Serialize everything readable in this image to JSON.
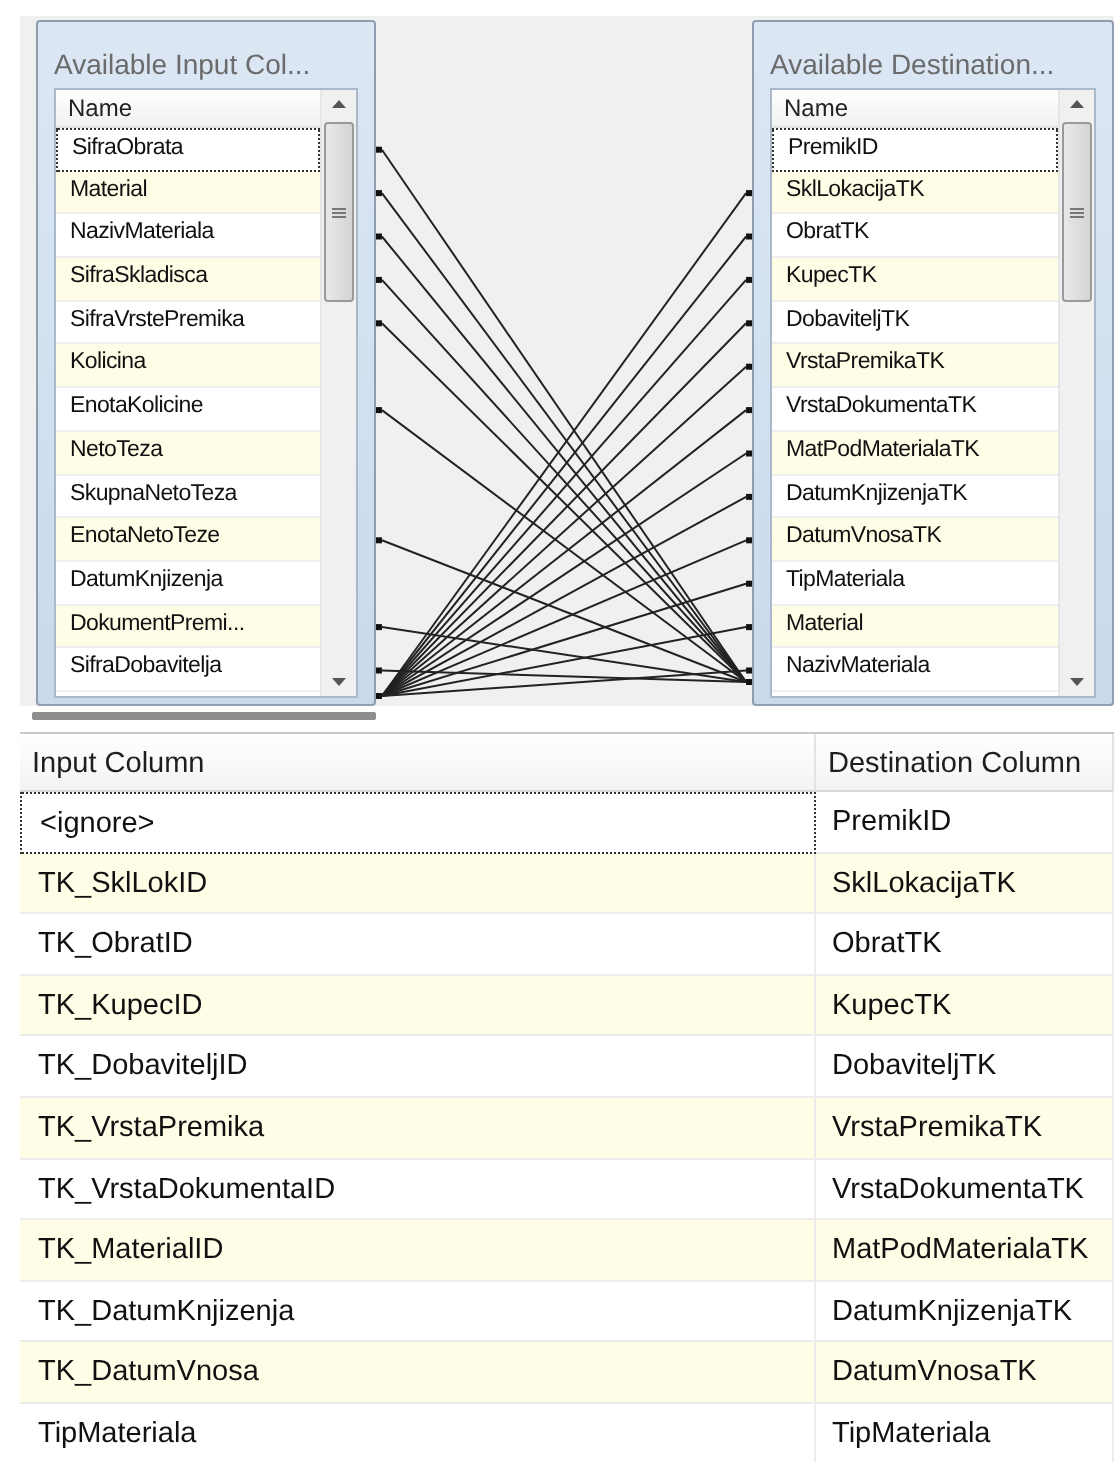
{
  "input_list": {
    "title": "Available Input Col...",
    "header": "Name",
    "items": [
      {
        "name": "SifraObrata",
        "focused": true,
        "mapped": true
      },
      {
        "name": "Material",
        "focused": false,
        "mapped": true
      },
      {
        "name": "NazivMateriala",
        "focused": false,
        "mapped": true
      },
      {
        "name": "SifraSkladisca",
        "focused": false,
        "mapped": true
      },
      {
        "name": "SifraVrstePremika",
        "focused": false,
        "mapped": true
      },
      {
        "name": "Kolicina",
        "focused": false,
        "mapped": false
      },
      {
        "name": "EnotaKolicine",
        "focused": false,
        "mapped": true
      },
      {
        "name": "NetoTeza",
        "focused": false,
        "mapped": false
      },
      {
        "name": "SkupnaNetoTeza",
        "focused": false,
        "mapped": false
      },
      {
        "name": "EnotaNetoTeze",
        "focused": false,
        "mapped": true
      },
      {
        "name": "DatumKnjizenja",
        "focused": false,
        "mapped": false
      },
      {
        "name": "DokumentPremi...",
        "focused": false,
        "mapped": true
      },
      {
        "name": "SifraDobavitelja",
        "focused": false,
        "mapped": true
      }
    ]
  },
  "destination_list": {
    "title": "Available Destination...",
    "header": "Name",
    "items": [
      {
        "name": "PremikID",
        "focused": true,
        "mapped": false
      },
      {
        "name": "SklLokacijaTK",
        "focused": false,
        "mapped": true
      },
      {
        "name": "ObratTK",
        "focused": false,
        "mapped": true
      },
      {
        "name": "KupecTK",
        "focused": false,
        "mapped": true
      },
      {
        "name": "DobaviteljTK",
        "focused": false,
        "mapped": true
      },
      {
        "name": "VrstaPremikaTK",
        "focused": false,
        "mapped": true
      },
      {
        "name": "VrstaDokumentaTK",
        "focused": false,
        "mapped": true
      },
      {
        "name": "MatPodMaterialaTK",
        "focused": false,
        "mapped": true
      },
      {
        "name": "DatumKnjizenjaTK",
        "focused": false,
        "mapped": true
      },
      {
        "name": "DatumVnosaTK",
        "focused": false,
        "mapped": true
      },
      {
        "name": "TipMateriala",
        "focused": false,
        "mapped": true
      },
      {
        "name": "Material",
        "focused": false,
        "mapped": true
      },
      {
        "name": "NazivMateriala",
        "focused": false,
        "mapped": true
      }
    ]
  },
  "mapping_table": {
    "columns": [
      "Input Column",
      "Destination Column"
    ],
    "rows": [
      {
        "input": "<ignore>",
        "destination": "PremikID",
        "focused": true
      },
      {
        "input": "TK_SklLokID",
        "destination": "SklLokacijaTK",
        "focused": false
      },
      {
        "input": "TK_ObratID",
        "destination": "ObratTK",
        "focused": false
      },
      {
        "input": "TK_KupecID",
        "destination": "KupecTK",
        "focused": false
      },
      {
        "input": "TK_DobaviteljID",
        "destination": "DobaviteljTK",
        "focused": false
      },
      {
        "input": "TK_VrstaPremika",
        "destination": "VrstaPremikaTK",
        "focused": false
      },
      {
        "input": "TK_VrstaDokumentaID",
        "destination": "VrstaDokumentaTK",
        "focused": false
      },
      {
        "input": "TK_MaterialID",
        "destination": "MatPodMaterialaTK",
        "focused": false
      },
      {
        "input": "TK_DatumKnjizenja",
        "destination": "DatumKnjizenjaTK",
        "focused": false
      },
      {
        "input": "TK_DatumVnosa",
        "destination": "DatumVnosaTK",
        "focused": false
      },
      {
        "input": "TipMateriala",
        "destination": "TipMateriala",
        "focused": false
      }
    ]
  }
}
